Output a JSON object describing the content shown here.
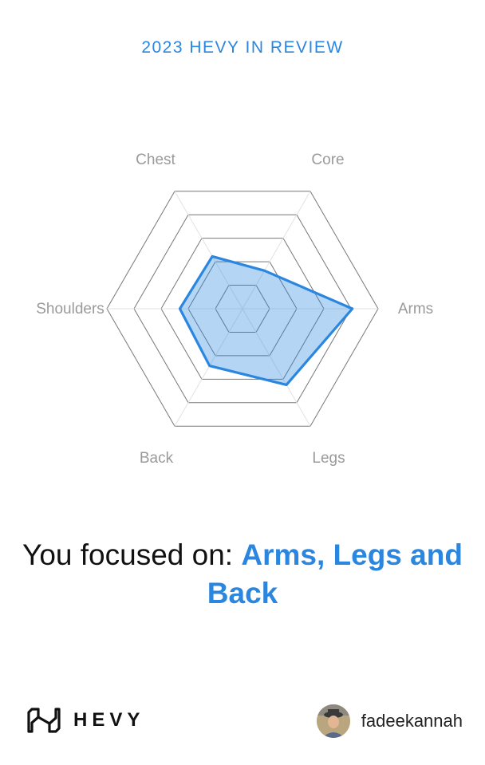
{
  "header": {
    "title": "2023 HEVY IN REVIEW"
  },
  "chart_data": {
    "type": "radar",
    "axes": [
      "Chest",
      "Core",
      "Arms",
      "Legs",
      "Back",
      "Shoulders"
    ],
    "values": [
      0.55,
      0.4,
      1.0,
      0.8,
      0.6,
      0.57
    ],
    "rings": 5,
    "colors": {
      "line": "#2b86e0",
      "fill": "#2b86e0"
    }
  },
  "headline": {
    "prefix": "You focused on: ",
    "focus": "Arms, Legs and Back"
  },
  "footer": {
    "brand": "HEVY",
    "username": "fadeekannah",
    "logo_icon": "hevy-logo-icon",
    "avatar_icon": "user-avatar"
  }
}
